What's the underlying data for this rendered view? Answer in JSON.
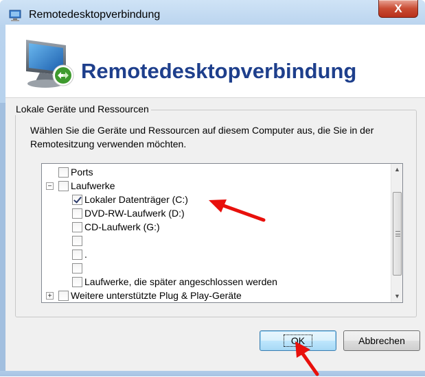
{
  "window": {
    "title": "Remotedesktopverbindung",
    "close_glyph": "X"
  },
  "banner": {
    "title": "Remotedesktopverbindung",
    "icon": "remote-desktop-monitor-icon"
  },
  "group": {
    "legend": "Lokale Geräte und Ressourcen",
    "description": "Wählen Sie die Geräte und Ressourcen auf diesem Computer aus, die Sie in der Remotesitzung verwenden möchten."
  },
  "tree": {
    "items": [
      {
        "label": "Ports",
        "checked": false,
        "level": 0,
        "expander": ""
      },
      {
        "label": "Laufwerke",
        "checked": false,
        "level": 0,
        "expander": "−"
      },
      {
        "label": "Lokaler Datenträger (C:)",
        "checked": true,
        "level": 1,
        "expander": ""
      },
      {
        "label": "DVD-RW-Laufwerk (D:)",
        "checked": false,
        "level": 1,
        "expander": ""
      },
      {
        "label": "CD-Laufwerk (G:)",
        "checked": false,
        "level": 1,
        "expander": ""
      },
      {
        "label": "",
        "checked": false,
        "level": 1,
        "expander": ""
      },
      {
        "label": ".",
        "checked": false,
        "level": 1,
        "expander": ""
      },
      {
        "label": "",
        "checked": false,
        "level": 1,
        "expander": ""
      },
      {
        "label": "Laufwerke, die später angeschlossen werden",
        "checked": false,
        "level": 1,
        "expander": ""
      },
      {
        "label": "Weitere unterstützte Plug & Play-Geräte",
        "checked": false,
        "level": 0,
        "expander": "+"
      }
    ]
  },
  "buttons": {
    "ok": "OK",
    "cancel": "Abbrechen"
  },
  "colors": {
    "banner_title": "#1e3f8c",
    "annotation_arrow": "#e8100c"
  }
}
